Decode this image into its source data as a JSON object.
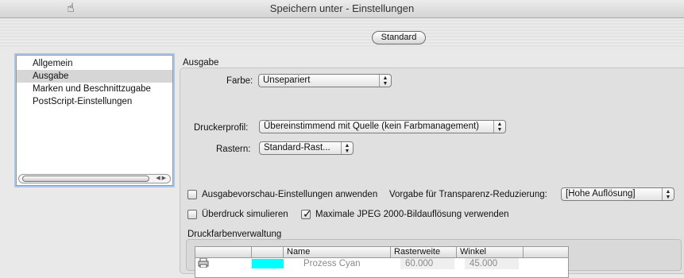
{
  "window": {
    "title": "Speichern unter - Einstellungen"
  },
  "toolbar": {
    "standard_label": "Standard"
  },
  "sidebar": {
    "items": [
      {
        "label": "Allgemein"
      },
      {
        "label": "Ausgabe"
      },
      {
        "label": "Marken und Beschnittzugabe"
      },
      {
        "label": "PostScript-Einstellungen"
      }
    ],
    "selected": "Ausgabe"
  },
  "ausgabe": {
    "title": "Ausgabe",
    "farbe_label": "Farbe:",
    "farbe_value": "Unsepariert",
    "druckerprofil_label": "Druckerprofil:",
    "druckerprofil_value": "Übereinstimmend mit Quelle (kein Farbmanagement)",
    "rastern_label": "Rastern:",
    "rastern_value": "Standard-Rast...",
    "vorschau_label": "Ausgabevorschau-Einstellungen anwenden",
    "vorschau_checked": false,
    "transparenz_label": "Vorgabe für Transparenz-Reduzierung:",
    "transparenz_value": "[Hohe Auflösung]",
    "ueberdruck_label": "Überdruck simulieren",
    "ueberdruck_checked": false,
    "jpeg_label": "Maximale JPEG 2000-Bildauflösung verwenden",
    "jpeg_checked": true
  },
  "druckfarben": {
    "title": "Druckfarbenverwaltung",
    "columns": [
      "Name",
      "Rasterweite",
      "Winkel"
    ],
    "rows": [
      {
        "color": "#00ffff",
        "name": "Prozess Cyan",
        "rasterweite": "60.000",
        "winkel": "45.000"
      }
    ]
  },
  "icons": {
    "cursor": "hand-cursor-icon",
    "printer": "printer-icon",
    "popup_arrows": "updown-arrow-icon",
    "checkmark": "checkmark-icon"
  }
}
